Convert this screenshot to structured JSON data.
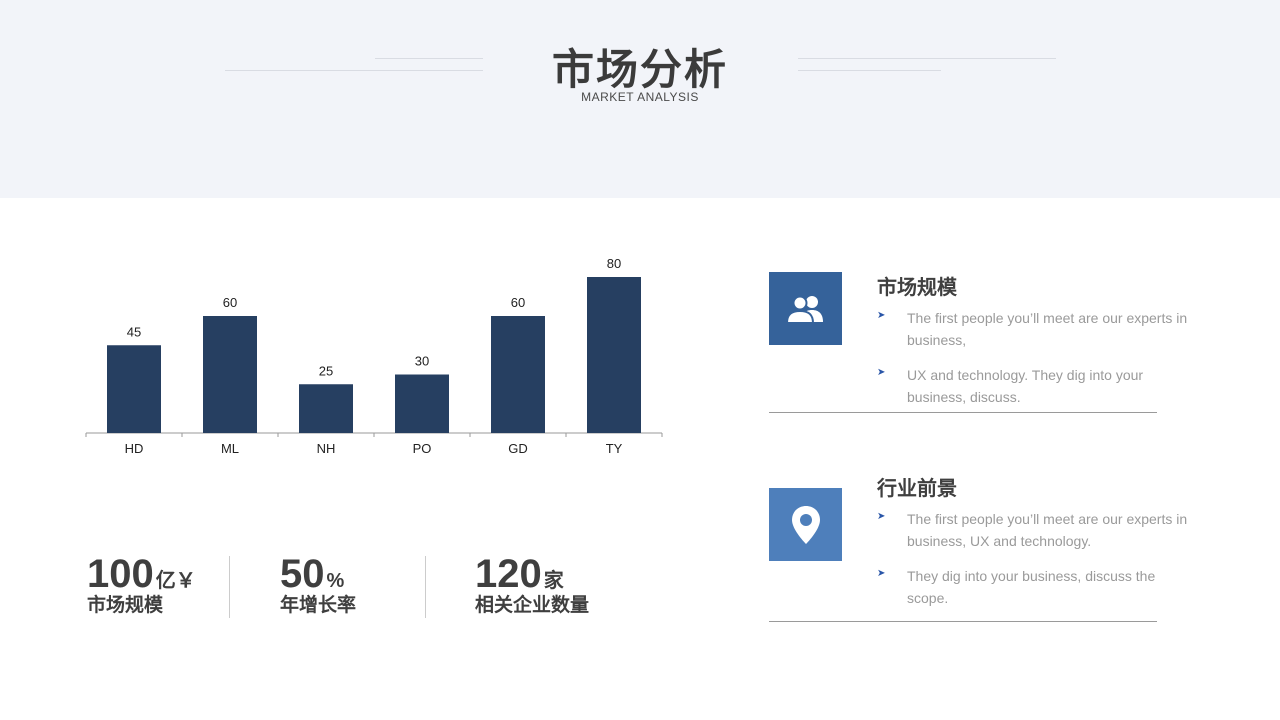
{
  "header": {
    "title": "市场分析",
    "subtitle": "MARKET ANALYSIS"
  },
  "chart_data": {
    "type": "bar",
    "categories": [
      "HD",
      "ML",
      "NH",
      "PO",
      "GD",
      "TY"
    ],
    "values": [
      45,
      60,
      25,
      30,
      60,
      80
    ],
    "ylim": [
      0,
      80
    ],
    "grid": false,
    "bar_color": "#263f61"
  },
  "stats": [
    {
      "value": "100",
      "unit": "亿￥",
      "label": "市场规模"
    },
    {
      "value": "50",
      "unit": "%",
      "label": "年增长率"
    },
    {
      "value": "120",
      "unit": "家",
      "label": "相关企业数量"
    }
  ],
  "cards": [
    {
      "icon": "users-icon",
      "icon_color": "#35629a",
      "title": "市场规模",
      "bullets": [
        "The first people you’ll meet are our experts in business,",
        "UX  and technology. They dig into your business, discuss."
      ]
    },
    {
      "icon": "location-pin-icon",
      "icon_color": "#4e7fbb",
      "title": "行业前景",
      "bullets": [
        "The first people you’ll meet are our experts in business, UX  and technology.",
        "They dig into your business, discuss the scope."
      ]
    }
  ]
}
